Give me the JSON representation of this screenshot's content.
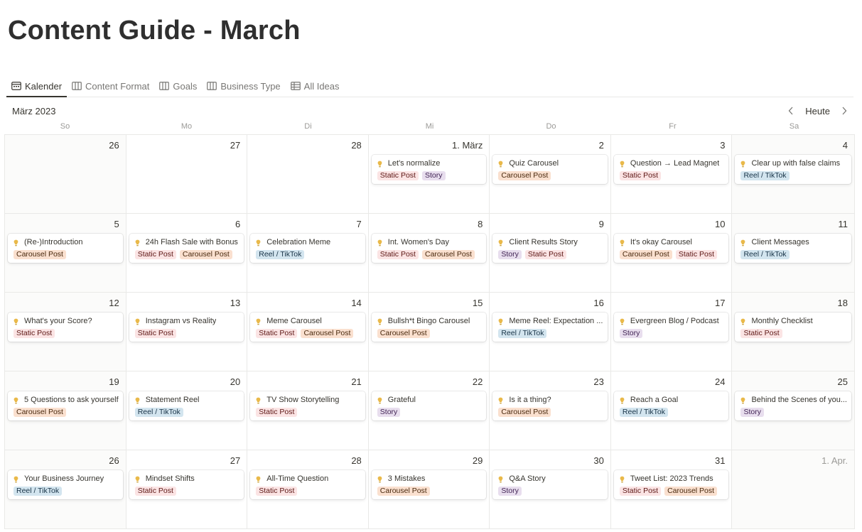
{
  "page": {
    "title": "Content Guide - March"
  },
  "tabs": [
    {
      "label": "Kalender",
      "icon": "calendar-icon",
      "active": true
    },
    {
      "label": "Content Format",
      "icon": "board-icon",
      "active": false
    },
    {
      "label": "Goals",
      "icon": "board-icon",
      "active": false
    },
    {
      "label": "Business Type",
      "icon": "board-icon",
      "active": false
    },
    {
      "label": "All Ideas",
      "icon": "table-icon",
      "active": false
    }
  ],
  "calendar": {
    "month_label": "März 2023",
    "today_label": "Heute",
    "weekdays": [
      "So",
      "Mo",
      "Di",
      "Mi",
      "Do",
      "Fr",
      "Sa"
    ],
    "tag_colors": {
      "Static Post": "tag-static",
      "Carousel Post": "tag-carousel",
      "Story": "tag-story",
      "Reel / TikTok": "tag-reel"
    },
    "weeks": [
      [
        {
          "label": "26",
          "muted": false,
          "entries": []
        },
        {
          "label": "27",
          "muted": false,
          "entries": []
        },
        {
          "label": "28",
          "muted": false,
          "entries": []
        },
        {
          "label": "1. März",
          "muted": false,
          "entries": [
            {
              "title": "Let's normalize",
              "tags": [
                "Static Post",
                "Story"
              ]
            }
          ]
        },
        {
          "label": "2",
          "muted": false,
          "entries": [
            {
              "title": "Quiz Carousel",
              "tags": [
                "Carousel Post"
              ]
            }
          ]
        },
        {
          "label": "3",
          "muted": false,
          "entries": [
            {
              "title": "Question → Lead Magnet",
              "tags": [
                "Static Post"
              ]
            }
          ]
        },
        {
          "label": "4",
          "muted": false,
          "entries": [
            {
              "title": "Clear up with false claims",
              "tags": [
                "Reel / TikTok"
              ]
            }
          ]
        }
      ],
      [
        {
          "label": "5",
          "muted": false,
          "entries": [
            {
              "title": "(Re-)Introduction",
              "tags": [
                "Carousel Post"
              ]
            }
          ]
        },
        {
          "label": "6",
          "muted": false,
          "entries": [
            {
              "title": "24h Flash Sale with Bonus",
              "tags": [
                "Static Post",
                "Carousel Post"
              ]
            }
          ]
        },
        {
          "label": "7",
          "muted": false,
          "entries": [
            {
              "title": "Celebration Meme",
              "tags": [
                "Reel / TikTok"
              ]
            }
          ]
        },
        {
          "label": "8",
          "muted": false,
          "entries": [
            {
              "title": "Int. Women's Day",
              "tags": [
                "Static Post",
                "Carousel Post"
              ]
            }
          ]
        },
        {
          "label": "9",
          "muted": false,
          "entries": [
            {
              "title": "Client Results Story",
              "tags": [
                "Story",
                "Static Post"
              ]
            }
          ]
        },
        {
          "label": "10",
          "muted": false,
          "entries": [
            {
              "title": "It's okay Carousel",
              "tags": [
                "Carousel Post",
                "Static Post"
              ]
            }
          ]
        },
        {
          "label": "11",
          "muted": false,
          "entries": [
            {
              "title": "Client Messages",
              "tags": [
                "Reel / TikTok"
              ]
            }
          ]
        }
      ],
      [
        {
          "label": "12",
          "muted": false,
          "entries": [
            {
              "title": "What's your Score?",
              "tags": [
                "Static Post"
              ]
            }
          ]
        },
        {
          "label": "13",
          "muted": false,
          "entries": [
            {
              "title": "Instagram vs Reality",
              "tags": [
                "Static Post"
              ]
            }
          ]
        },
        {
          "label": "14",
          "muted": false,
          "entries": [
            {
              "title": "Meme Carousel",
              "tags": [
                "Static Post",
                "Carousel Post"
              ]
            }
          ]
        },
        {
          "label": "15",
          "muted": false,
          "entries": [
            {
              "title": "Bullsh*t Bingo Carousel",
              "tags": [
                "Carousel Post"
              ]
            }
          ]
        },
        {
          "label": "16",
          "muted": false,
          "entries": [
            {
              "title": "Meme Reel: Expectation ...",
              "tags": [
                "Reel / TikTok"
              ]
            }
          ]
        },
        {
          "label": "17",
          "muted": false,
          "entries": [
            {
              "title": "Evergreen Blog / Podcast",
              "tags": [
                "Story"
              ]
            }
          ]
        },
        {
          "label": "18",
          "muted": false,
          "entries": [
            {
              "title": "Monthly Checklist",
              "tags": [
                "Static Post"
              ]
            }
          ]
        }
      ],
      [
        {
          "label": "19",
          "muted": false,
          "entries": [
            {
              "title": "5 Questions to ask yourself",
              "tags": [
                "Carousel Post"
              ]
            }
          ]
        },
        {
          "label": "20",
          "muted": false,
          "entries": [
            {
              "title": "Statement Reel",
              "tags": [
                "Reel / TikTok"
              ]
            }
          ]
        },
        {
          "label": "21",
          "muted": false,
          "entries": [
            {
              "title": "TV Show Storytelling",
              "tags": [
                "Static Post"
              ]
            }
          ]
        },
        {
          "label": "22",
          "muted": false,
          "entries": [
            {
              "title": "Grateful",
              "tags": [
                "Story"
              ]
            }
          ]
        },
        {
          "label": "23",
          "muted": false,
          "entries": [
            {
              "title": "Is it a thing?",
              "tags": [
                "Carousel Post"
              ]
            }
          ]
        },
        {
          "label": "24",
          "muted": false,
          "entries": [
            {
              "title": "Reach a Goal",
              "tags": [
                "Reel / TikTok"
              ]
            }
          ]
        },
        {
          "label": "25",
          "muted": false,
          "entries": [
            {
              "title": "Behind the Scenes of you...",
              "tags": [
                "Story"
              ]
            }
          ]
        }
      ],
      [
        {
          "label": "26",
          "muted": false,
          "entries": [
            {
              "title": "Your Business Journey",
              "tags": [
                "Reel / TikTok"
              ]
            }
          ]
        },
        {
          "label": "27",
          "muted": false,
          "entries": [
            {
              "title": "Mindset Shifts",
              "tags": [
                "Static Post"
              ]
            }
          ]
        },
        {
          "label": "28",
          "muted": false,
          "entries": [
            {
              "title": "All-Time Question",
              "tags": [
                "Static Post"
              ]
            }
          ]
        },
        {
          "label": "29",
          "muted": false,
          "entries": [
            {
              "title": "3 Mistakes",
              "tags": [
                "Carousel Post"
              ]
            }
          ]
        },
        {
          "label": "30",
          "muted": false,
          "entries": [
            {
              "title": "Q&A Story",
              "tags": [
                "Story"
              ]
            }
          ]
        },
        {
          "label": "31",
          "muted": false,
          "entries": [
            {
              "title": "Tweet List: 2023 Trends",
              "tags": [
                "Static Post",
                "Carousel Post"
              ]
            }
          ]
        },
        {
          "label": "1. Apr.",
          "muted": true,
          "entries": []
        }
      ]
    ]
  },
  "icons": {
    "entry_icon": "lightbulb-icon",
    "prev": "chevron-left-icon",
    "next": "chevron-right-icon"
  },
  "colors": {
    "bulb": "#e9b94a",
    "border": "#e9e9e7",
    "text": "#37352f"
  }
}
